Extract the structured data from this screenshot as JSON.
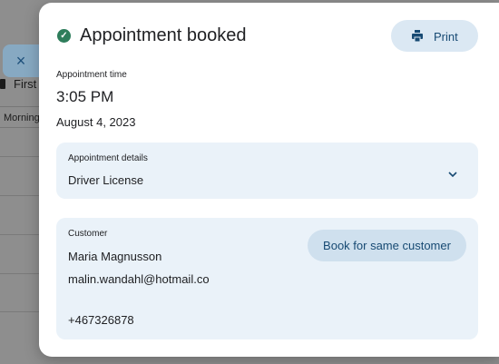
{
  "background": {
    "close_symbol": "×",
    "first_label": "First",
    "morning_label": "Morning"
  },
  "dialog": {
    "status_icon": "check-circle-icon",
    "title": "Appointment booked",
    "print_label": "Print",
    "appointment_time_label": "Appointment time",
    "time": "3:05 PM",
    "date": "August 4, 2023",
    "details": {
      "label": "Appointment details",
      "value": "Driver License"
    },
    "customer": {
      "label": "Customer",
      "name": "Maria Magnusson",
      "email": "malin.wandahl@hotmail.co",
      "phone": "+467326878",
      "book_same_label": "Book for same customer"
    }
  },
  "colors": {
    "accent": "#174a73",
    "success": "#2e7d5b",
    "card_bg": "#eaf2f9",
    "button_bg": "#dbe8f3"
  }
}
